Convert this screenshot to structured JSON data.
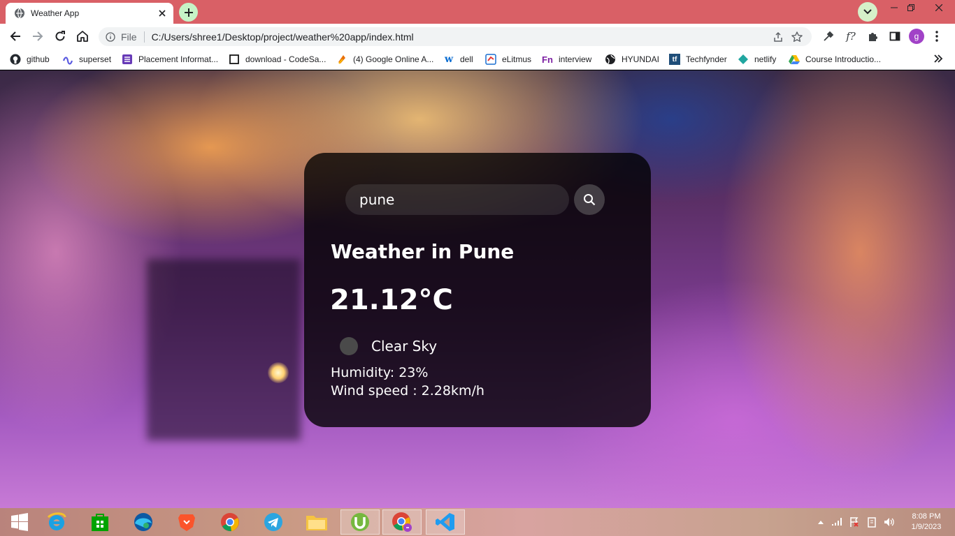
{
  "browser": {
    "tab_title": "Weather App",
    "scheme_label": "File",
    "url": "C:/Users/shree1/Desktop/project/weather%20app/index.html",
    "ext_f_label": "f?",
    "avatar_letter": "g"
  },
  "bookmarks": [
    {
      "label": "github",
      "icon": "github-icon"
    },
    {
      "label": "superset",
      "icon": "superset-icon"
    },
    {
      "label": "Placement Informat...",
      "icon": "form-icon"
    },
    {
      "label": "download - CodeSa...",
      "icon": "checkbox-icon"
    },
    {
      "label": "(4) Google Online A...",
      "icon": "cycle-icon"
    },
    {
      "label": "dell",
      "icon": "w-icon"
    },
    {
      "label": "eLitmus",
      "icon": "elitmus-icon"
    },
    {
      "label": "interview",
      "icon": "fn-icon"
    },
    {
      "label": "HYUNDAI",
      "icon": "globe-icon"
    },
    {
      "label": "Techfynder",
      "icon": "tf-icon"
    },
    {
      "label": "netlify",
      "icon": "netlify-icon"
    },
    {
      "label": "Course Introductio...",
      "icon": "drive-icon"
    }
  ],
  "weather": {
    "search_value": "pune",
    "city_title": "Weather in Pune",
    "temperature": "21.12°C",
    "description": "Clear Sky",
    "humidity": "Humidity: 23%",
    "wind": "Wind speed : 2.28km/h"
  },
  "taskbar": {
    "apps": [
      "start",
      "internet-explorer",
      "store",
      "edge",
      "brave",
      "chrome",
      "telegram",
      "file-explorer",
      "utorrent",
      "chrome-active",
      "vscode"
    ],
    "time": "8:08 PM",
    "date": "1/9/2023"
  },
  "colors": {
    "tabstrip": "#d96066",
    "card_bg": "rgba(0,0,0,0.78)"
  }
}
